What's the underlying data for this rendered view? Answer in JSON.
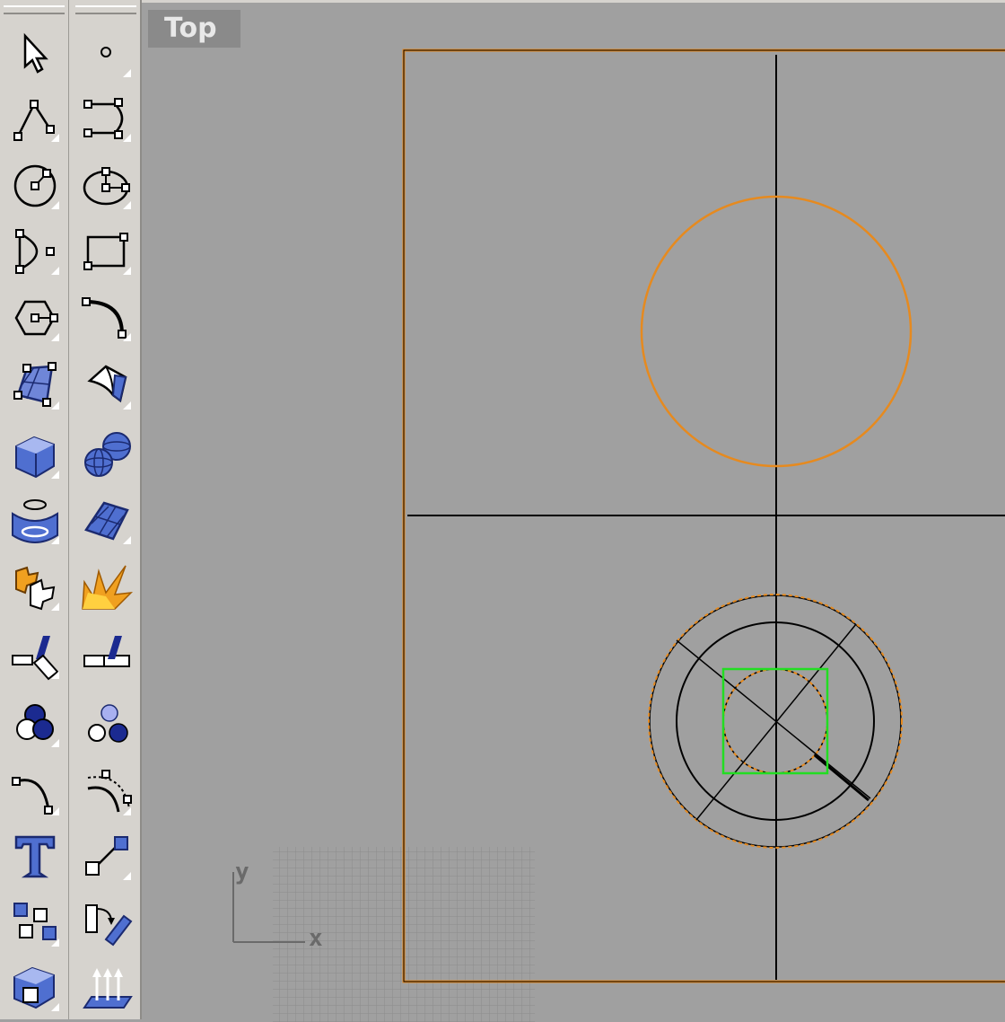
{
  "viewport": {
    "label": "Top",
    "axis_x_label": "x",
    "axis_y_label": "y",
    "colors": {
      "background": "#a0a0a0",
      "selected_curve": "#e68a1f",
      "curve": "#000000",
      "highlight": "#22dd22",
      "grid": "#8c8c8c"
    }
  },
  "toolbar": {
    "left_column": [
      "select-arrow-icon",
      "polyline-icon",
      "circle-center-radius-icon",
      "arc-icon",
      "polygon-icon",
      "surface-from-points-icon",
      "box-solid-icon",
      "cylinder-icon",
      "boolean-tools-icon",
      "dimension-icon",
      "render-icon",
      "curve-fillet-icon",
      "text-icon",
      "group-icon",
      "transform-icon"
    ],
    "right_column": [
      "point-icon",
      "curve-from-points-icon",
      "ellipse-icon",
      "rectangle-icon",
      "curve-tools-icon",
      "surface-tools-icon",
      "sphere-icon",
      "patch-surface-icon",
      "explode-icon",
      "osnap-icon",
      "lights-icon",
      "offset-curve-icon",
      "line-icon",
      "move-rotate-icon",
      "extrude-icon"
    ]
  }
}
